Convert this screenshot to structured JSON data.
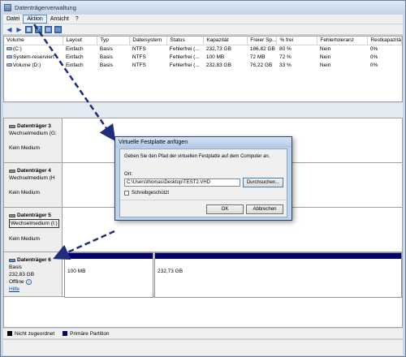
{
  "window": {
    "title": "Datenträgerverwaltung"
  },
  "menu": [
    {
      "label": "Datei",
      "active": false
    },
    {
      "label": "Aktion",
      "active": true
    },
    {
      "label": "Ansicht",
      "active": false
    },
    {
      "label": "?",
      "active": false
    }
  ],
  "toolbar": {
    "icons": [
      "back-arrow-icon",
      "forward-arrow-icon",
      "console-icon",
      "help-icon",
      "properties-icon",
      "window-icon"
    ]
  },
  "volumes": {
    "headers": [
      "Volume",
      "Layout",
      "Typ",
      "Dateisystem",
      "Status",
      "Kapazität",
      "Freier Sp...",
      "% frei",
      "Fehlertoleranz",
      "Restkapazitä"
    ],
    "rows": [
      [
        "(C:)",
        "Einfach",
        "Basis",
        "NTFS",
        "Fehlerfrei (...",
        "232,73 GB",
        "186,82 GB",
        "80 %",
        "Nein",
        "0%"
      ],
      [
        "System-reserviert",
        "Einfach",
        "Basis",
        "NTFS",
        "Fehlerfrei (...",
        "100 MB",
        "72 MB",
        "72 %",
        "Nein",
        "0%"
      ],
      [
        "Volume (D:)",
        "Einfach",
        "Basis",
        "NTFS",
        "Fehlerfrei (...",
        "232,83 GB",
        "76,22 GB",
        "33 %",
        "Nein",
        "0%"
      ]
    ]
  },
  "disks": [
    {
      "name": "Datenträger 3",
      "type": "Wechselmedium (G:",
      "status": "Kein Medium"
    },
    {
      "name": "Datenträger 4",
      "type": "Wechselmedium (H",
      "status": "Kein Medium"
    },
    {
      "name": "Datenträger 5",
      "type": "Wechselmedium (I:)",
      "status": "Kein Medium"
    },
    {
      "name": "Datenträger 6",
      "type": "Basis",
      "size": "232,83 GB",
      "status": "Offline",
      "help": "Hilfe",
      "partitions": [
        {
          "label": "100 MB"
        },
        {
          "label": "232,73 GB"
        }
      ]
    }
  ],
  "legend": [
    {
      "label": "Nicht zugeordnet",
      "color": "#000000"
    },
    {
      "label": "Primäre Partition",
      "color": "#00006e"
    }
  ],
  "dialog": {
    "title": "Virtuelle Festplatte anfügen",
    "description": "Geben Sie den Pfad der virtuellen Festplatte auf dem Computer an.",
    "location_label": "Ort:",
    "location_value": "C:\\Users\\thomas\\Desktop\\TEST2.VHD",
    "browse_label": "Durchsuchen...",
    "readonly_label": "Schreibgeschützt",
    "ok_label": "OK",
    "cancel_label": "Abbrechen"
  },
  "colors": {
    "partition_bar": "#00006e",
    "arrow": "#1f2d7a"
  }
}
